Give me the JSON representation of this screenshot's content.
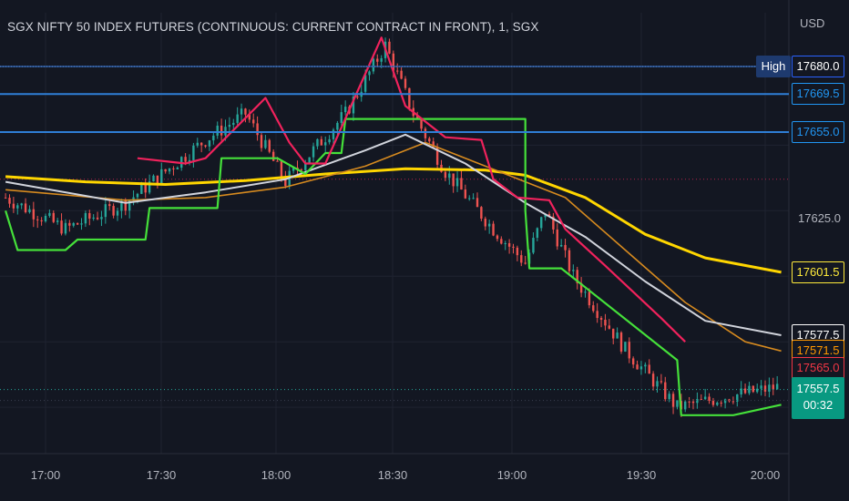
{
  "header": {
    "title": "SGX NIFTY 50 INDEX FUTURES (CONTINUOUS: CURRENT CONTRACT IN FRONT), 1, SGX",
    "currency": "USD"
  },
  "high_badge": "High",
  "price_axis": {
    "tick_labels": [
      "17625.0"
    ],
    "tags": [
      {
        "label": "17680.0",
        "value": 17680.0,
        "bg": "#131722",
        "fg": "#ffffff",
        "border": "#2962ff"
      },
      {
        "label": "17669.5",
        "value": 17669.5,
        "bg": "#131722",
        "fg": "#2196f3",
        "border": "#2196f3"
      },
      {
        "label": "17655.0",
        "value": 17655.0,
        "bg": "#131722",
        "fg": "#2196f3",
        "border": "#2196f3"
      },
      {
        "label": "17601.5",
        "value": 17601.5,
        "bg": "#131722",
        "fg": "#ffeb3b",
        "border": "#ffeb3b"
      },
      {
        "label": "17577.5",
        "value": 17577.5,
        "bg": "#131722",
        "fg": "#ffffff",
        "border": "#ffffff"
      },
      {
        "label": "17571.5",
        "value": 17571.5,
        "bg": "#131722",
        "fg": "#ff9800",
        "border": "#ff9800"
      },
      {
        "label": "17565.0",
        "value": 17565.0,
        "bg": "#131722",
        "fg": "#f23645",
        "border": "#f23645"
      }
    ],
    "last_price": {
      "label": "17557.5",
      "countdown": "00:32",
      "value": 17557.5,
      "bg": "#089981",
      "fg": "#ffffff"
    }
  },
  "time_axis": {
    "labels": [
      "17:00",
      "17:30",
      "18:00",
      "18:30",
      "19:00",
      "19:30",
      "20:00"
    ]
  },
  "colors": {
    "background": "#131722",
    "grid": "#1f2330",
    "up": "#26a69a",
    "down": "#ef5350",
    "ema_yellow": "#ffd600",
    "ema_orange": "#d68a1f",
    "ema_white": "#d1d4dc",
    "stop_green": "#45e03a",
    "stop_red": "#f0225c",
    "level_blue": "#2f7fd6"
  },
  "chart_data": {
    "type": "candlestick",
    "y_range": [
      17540,
      17690
    ],
    "x_range": [
      "16:50",
      "20:04"
    ],
    "horizontal_levels": [
      17680.0,
      17669.5,
      17655.0
    ],
    "high_marker": 17680.0,
    "last_price": 17557.5,
    "sma_yellow": [
      [
        "16:50",
        17638.0
      ],
      [
        "17:10",
        17636.0
      ],
      [
        "17:30",
        17635.0
      ],
      [
        "17:50",
        17636.5
      ],
      [
        "18:10",
        17639.0
      ],
      [
        "18:30",
        17641.0
      ],
      [
        "18:50",
        17640.5
      ],
      [
        "19:00",
        17638.5
      ],
      [
        "19:15",
        17630.0
      ],
      [
        "19:30",
        17616.0
      ],
      [
        "19:45",
        17607.0
      ],
      [
        "20:04",
        17601.5
      ]
    ],
    "ema_orange": [
      [
        "16:50",
        17633.0
      ],
      [
        "17:20",
        17629.0
      ],
      [
        "17:40",
        17630.0
      ],
      [
        "18:00",
        17634.0
      ],
      [
        "18:20",
        17642.0
      ],
      [
        "18:35",
        17651.0
      ],
      [
        "18:50",
        17642.0
      ],
      [
        "19:10",
        17630.0
      ],
      [
        "19:25",
        17610.0
      ],
      [
        "19:40",
        17590.0
      ],
      [
        "19:55",
        17575.0
      ],
      [
        "20:04",
        17571.5
      ]
    ],
    "ema_white": [
      [
        "16:50",
        17636.0
      ],
      [
        "17:20",
        17628.0
      ],
      [
        "17:40",
        17632.0
      ],
      [
        "18:00",
        17637.0
      ],
      [
        "18:20",
        17648.0
      ],
      [
        "18:30",
        17654.0
      ],
      [
        "18:45",
        17643.0
      ],
      [
        "19:00",
        17628.0
      ],
      [
        "19:15",
        17615.0
      ],
      [
        "19:30",
        17598.0
      ],
      [
        "19:45",
        17583.0
      ],
      [
        "20:04",
        17577.5
      ]
    ],
    "stop_green": [
      [
        "16:50",
        17625.0
      ],
      [
        "16:53",
        17610.0
      ],
      [
        "17:05",
        17610.0
      ],
      [
        "17:08",
        17614.0
      ],
      [
        "17:25",
        17614.0
      ],
      [
        "17:26",
        17626.0
      ],
      [
        "17:43",
        17626.0
      ],
      [
        "17:44",
        17645.0
      ],
      [
        "17:58",
        17645.0
      ],
      [
        "18:05",
        17639.0
      ],
      [
        "18:10",
        17647.0
      ],
      [
        "18:14",
        17647.0
      ],
      [
        "18:15",
        17660.0
      ],
      [
        "18:25",
        17660.0
      ],
      [
        "19:00",
        17660.0
      ],
      [
        "19:00",
        17625.0
      ],
      [
        "19:01",
        17603.0
      ],
      [
        "19:09",
        17603.0
      ],
      [
        "19:38",
        17568.0
      ],
      [
        "19:39",
        17547.0
      ],
      [
        "19:52",
        17547.0
      ],
      [
        "20:04",
        17551.0
      ]
    ],
    "stop_red": [
      [
        "17:23",
        17645.0
      ],
      [
        "17:35",
        17643.0
      ],
      [
        "17:40",
        17645.0
      ],
      [
        "17:55",
        17668.0
      ],
      [
        "18:01",
        17651.0
      ],
      [
        "18:05",
        17643.0
      ],
      [
        "18:10",
        17643.0
      ],
      [
        "18:24",
        17691.0
      ],
      [
        "18:30",
        17665.0
      ],
      [
        "18:40",
        17653.0
      ],
      [
        "18:49",
        17652.0
      ],
      [
        "18:52",
        17637.0
      ],
      [
        "18:58",
        17630.0
      ],
      [
        "19:06",
        17629.0
      ],
      [
        "19:10",
        17618.0
      ],
      [
        "19:20",
        17604.0
      ],
      [
        "19:34",
        17584.0
      ],
      [
        "19:40",
        17575.0
      ]
    ],
    "candles_summary": {
      "open": 17630.0,
      "high": 17692.0,
      "low": 17542.0,
      "close": 17557.5
    }
  }
}
